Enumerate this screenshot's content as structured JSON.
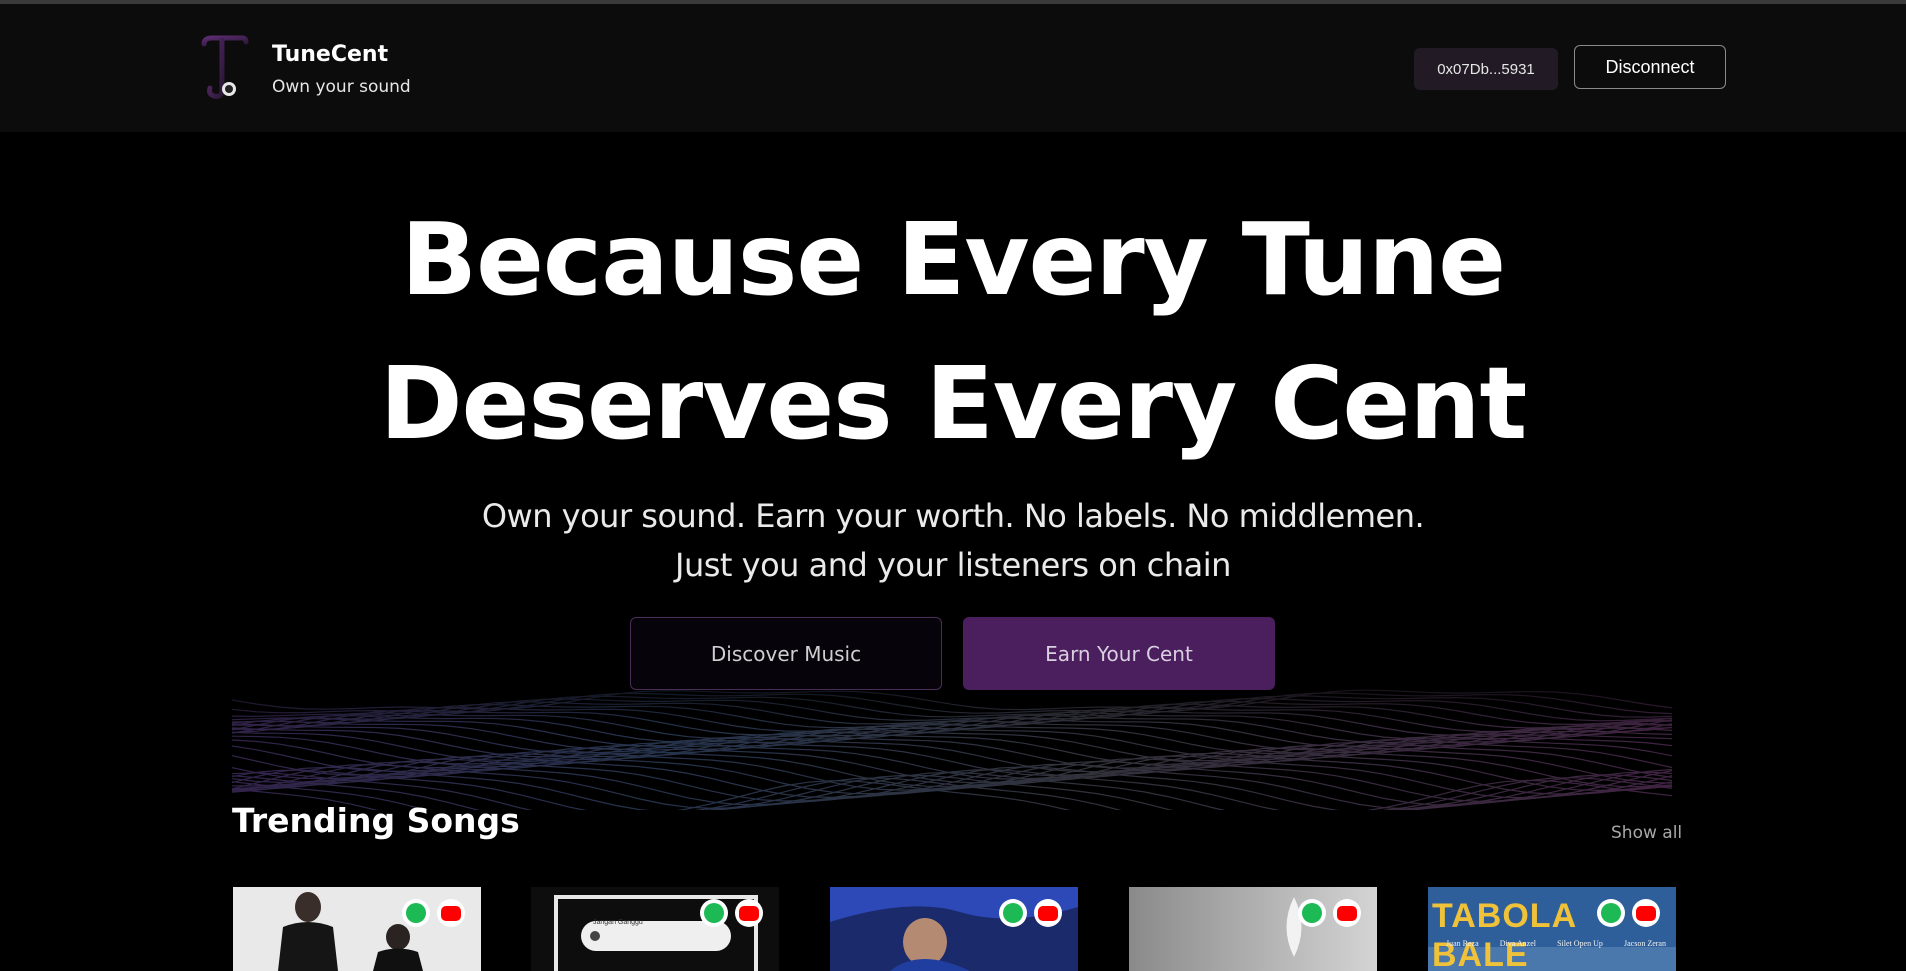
{
  "header": {
    "brand_name": "TuneCent",
    "brand_tagline": "Own your sound",
    "wallet_address": "0x07Db...5931",
    "disconnect_label": "Disconnect"
  },
  "hero": {
    "title_line1": "Because Every Tune",
    "title_line2": "Deserves Every Cent",
    "subtitle_line1": "Own your sound. Earn your worth. No labels. No middlemen.",
    "subtitle_line2": "Just you and your listeners on chain",
    "discover_label": "Discover Music",
    "earn_label": "Earn Your Cent"
  },
  "trending": {
    "title": "Trending Songs",
    "show_all_label": "Show all",
    "cards": [
      {
        "badges": [
          "spotify-icon",
          "youtube-icon"
        ]
      },
      {
        "badges": [
          "spotify-icon",
          "youtube-icon"
        ],
        "art_text": "Jangan Ganggu"
      },
      {
        "badges": [
          "spotify-icon",
          "youtube-icon"
        ]
      },
      {
        "badges": [
          "spotify-icon",
          "youtube-icon"
        ]
      },
      {
        "badges": [
          "spotify-icon",
          "youtube-icon"
        ],
        "art_text": "TABOLA BALE",
        "art_names": [
          "Juan Reza",
          "Diva Anzel",
          "Silet Open Up",
          "Jacson Zeran"
        ]
      }
    ]
  },
  "colors": {
    "background": "#000000",
    "header_bg": "#0c0c0c",
    "accent_purple": "#4b1f5e",
    "wallet_bg": "#221b26",
    "spotify_green": "#1db954",
    "youtube_red": "#ff0000"
  }
}
